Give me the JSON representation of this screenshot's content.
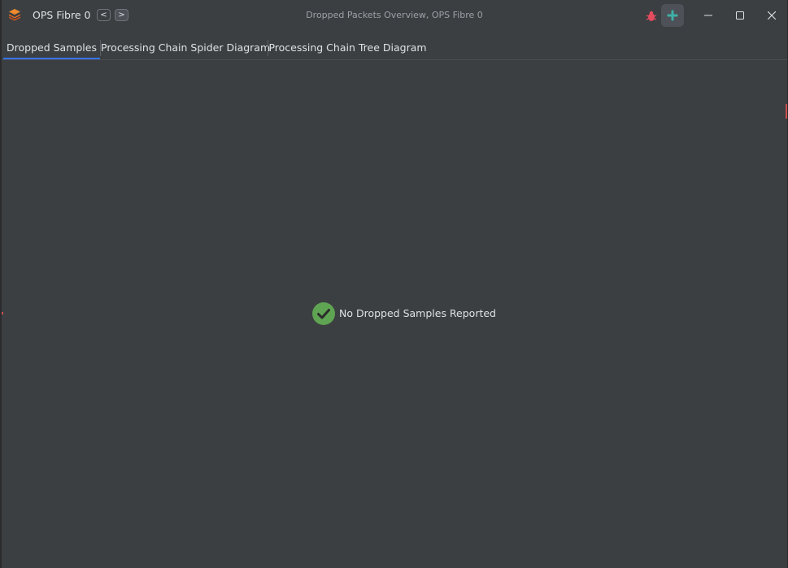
{
  "titlebar": {
    "app_title": "OPS Fibre 0",
    "back_label": "<",
    "forward_label": ">",
    "window_title": "Dropped Packets Overview, OPS Fibre 0",
    "icons": {
      "app": "layers-icon",
      "bug": "bug-icon",
      "add": "plus-icon",
      "minimize": "minimize-icon",
      "maximize": "maximize-icon",
      "close": "close-icon"
    }
  },
  "tabs": [
    {
      "label": "Dropped Samples",
      "active": true
    },
    {
      "label": "Processing Chain Spider Diagram",
      "active": false
    },
    {
      "label": "Processing Chain Tree Diagram",
      "active": false
    }
  ],
  "content": {
    "status_text": "No Dropped Samples Reported",
    "status_icon": "check-circle-icon"
  },
  "colors": {
    "background": "#3c3f41",
    "text": "#dfe1e5",
    "accent": "#3574f0",
    "success": "#5fa452",
    "add_icon": "#3fb0a6",
    "bug_icon": "#e34b5f",
    "app_icon": "#e8691e"
  }
}
